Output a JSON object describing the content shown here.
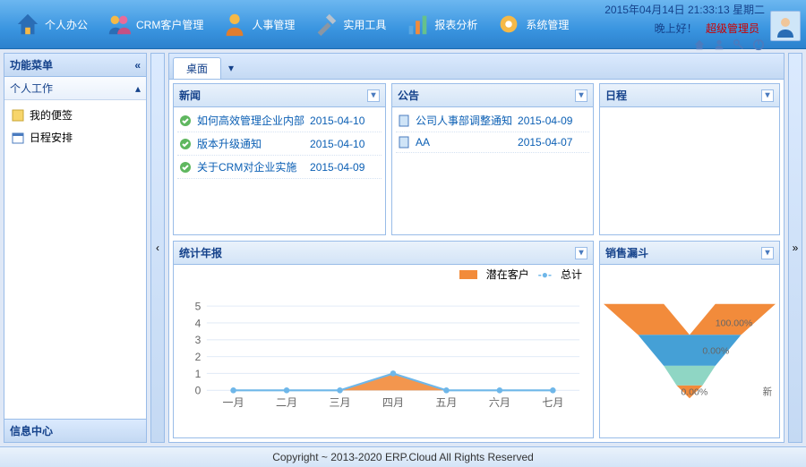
{
  "header": {
    "datetime": "2015年04月14日 21:33:13 星期二",
    "greeting": "晚上好！",
    "username": "超级管理员"
  },
  "nav": [
    {
      "label": "个人办公"
    },
    {
      "label": "CRM客户管理"
    },
    {
      "label": "人事管理"
    },
    {
      "label": "实用工具"
    },
    {
      "label": "报表分析"
    },
    {
      "label": "系统管理"
    }
  ],
  "sidebar": {
    "title": "功能菜单",
    "section": "个人工作",
    "items": [
      {
        "label": "我的便签"
      },
      {
        "label": "日程安排"
      }
    ],
    "bottom": "信息中心"
  },
  "tabs": {
    "active": "桌面"
  },
  "panels": {
    "news": {
      "title": "新闻",
      "items": [
        {
          "title": "如何高效管理企业内部",
          "date": "2015-04-10"
        },
        {
          "title": "版本升级通知",
          "date": "2015-04-10"
        },
        {
          "title": "关于CRM对企业实施",
          "date": "2015-04-09"
        }
      ]
    },
    "notice": {
      "title": "公告",
      "items": [
        {
          "title": "公司人事部调整通知",
          "date": "2015-04-09"
        },
        {
          "title": "AA",
          "date": "2015-04-07"
        }
      ]
    },
    "schedule": {
      "title": "日程"
    },
    "stats": {
      "title": "统计年报"
    },
    "funnel": {
      "title": "销售漏斗"
    }
  },
  "chart_data": [
    {
      "type": "line",
      "title": "统计年报",
      "categories": [
        "一月",
        "二月",
        "三月",
        "四月",
        "五月",
        "六月",
        "七月"
      ],
      "series": [
        {
          "name": "潜在客户",
          "values": [
            0,
            0,
            0,
            1,
            0,
            0,
            0
          ],
          "style": "area",
          "color": "#f28b3b"
        },
        {
          "name": "总计",
          "values": [
            0,
            0,
            0,
            1,
            0,
            0,
            0
          ],
          "style": "line",
          "color": "#6fb7e9"
        }
      ],
      "ylim": [
        0,
        5
      ],
      "yticks": [
        0,
        1,
        2,
        3,
        4,
        5
      ]
    },
    {
      "type": "funnel",
      "title": "销售漏斗",
      "slices": [
        {
          "label": "100.00%",
          "value": 100,
          "color": "#45a0d6"
        },
        {
          "label": "0.00%",
          "value": 0,
          "color": "#8fd6c4"
        },
        {
          "label": "0.00%",
          "value": 0,
          "color": "#f28b3b"
        }
      ],
      "side_label": "新"
    }
  ],
  "footer": "Copyright ~ 2013-2020 ERP.Cloud All Rights Reserved"
}
